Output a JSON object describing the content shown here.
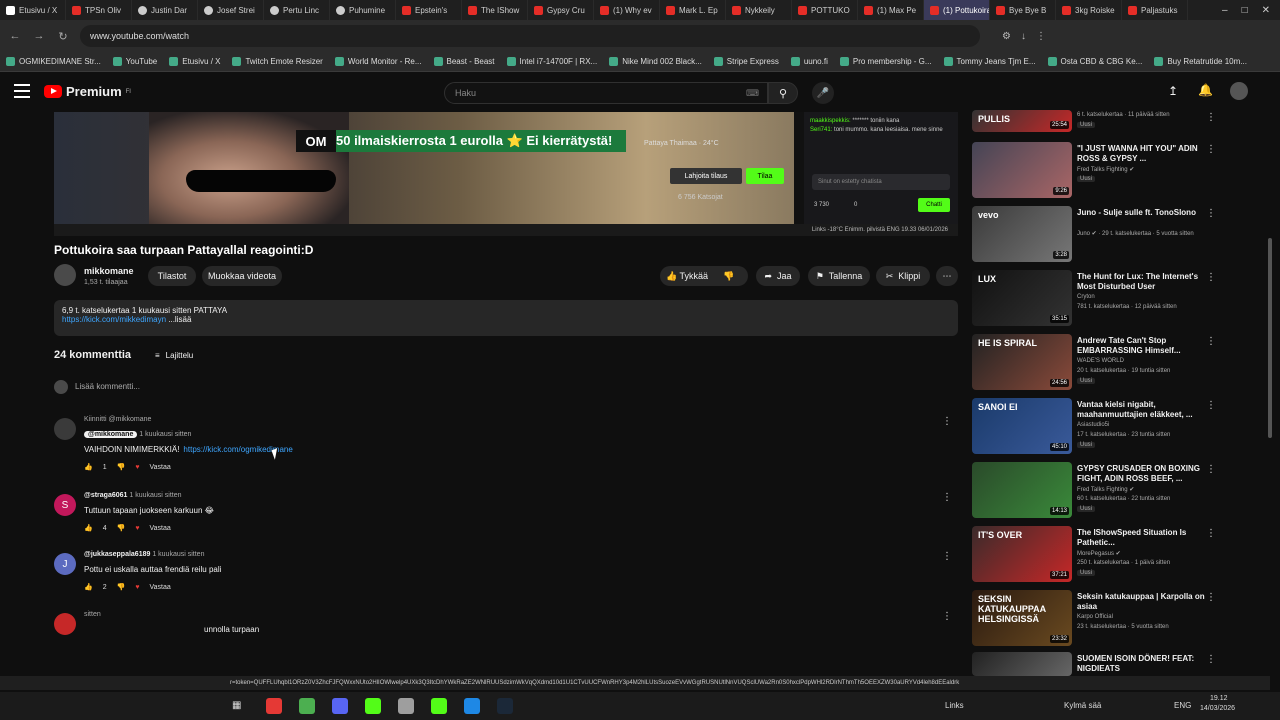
{
  "browser": {
    "tabs": [
      {
        "label": "Etusivu / X",
        "icon": "x-icon"
      },
      {
        "label": "TPSn Oliv",
        "icon": "youtube-icon"
      },
      {
        "label": "Justin Dar",
        "icon": "github-icon"
      },
      {
        "label": "Josef Strei",
        "icon": "github-icon"
      },
      {
        "label": "Pertu Linc",
        "icon": "github-icon"
      },
      {
        "label": "Puhumine",
        "icon": "github-icon"
      },
      {
        "label": "Epstein's",
        "icon": "youtube-icon"
      },
      {
        "label": "The IShow",
        "icon": "youtube-icon"
      },
      {
        "label": "Gypsy Cru",
        "icon": "youtube-icon"
      },
      {
        "label": "(1) Why ev",
        "icon": "youtube-icon"
      },
      {
        "label": "Mark L. Ep",
        "icon": "youtube-icon"
      },
      {
        "label": "Nykkeily",
        "icon": "youtube-icon"
      },
      {
        "label": "POTTUKO",
        "icon": "youtube-icon"
      },
      {
        "label": "(1) Max Pe",
        "icon": "youtube-icon"
      },
      {
        "label": "(1) Pottukoira",
        "icon": "youtube-icon",
        "active": true
      },
      {
        "label": "Bye Bye B",
        "icon": "youtube-icon"
      },
      {
        "label": "3kg Roiske",
        "icon": "youtube-icon"
      },
      {
        "label": "Paljastuks",
        "icon": "youtube-icon"
      }
    ],
    "url": "www.youtube.com/watch",
    "bookmarks": [
      "OGMIKEDIMANE Str...",
      "YouTube",
      "Etusivu / X",
      "Twitch Emote Resizer",
      "World Monitor - Re...",
      "Beast - Beast",
      "Intel i7-14700F | RX...",
      "Nike Mind 002 Black...",
      "Stripe Express",
      "uuno.fi",
      "Pro membership - G...",
      "Tommy Jeans Tjm E...",
      "Osta CBD & CBG Ke...",
      "Buy Retatrutide 10m..."
    ]
  },
  "youtube": {
    "logo": "Premium",
    "logo_sup": "FI",
    "search_placeholder": "Haku"
  },
  "video_overlay": {
    "banner_prefix": "OM",
    "banner": "50 ilmaiskierrosta 1 eurolla ⭐ Ei kierrätystä!",
    "weather": "Pattaya Thaimaa · 24°C",
    "gift_label": "Lahjoita tilaus",
    "follow_label": "Tilaa",
    "viewers": "6 756 Katsojat",
    "chat_lines": [
      {
        "name": "maakkispekkis:",
        "text": "******* toniin kana"
      },
      {
        "name": "Seri741:",
        "text": "toni mummo. kana leesiaisa. mene sinne"
      }
    ],
    "chat_input": "Sinut on estetty chatista",
    "chat_count": "3 730",
    "chat_zero": "0",
    "chat_button": "Chatti",
    "taskbar_text": "Links  -18°C Enimm. pilvistä  ENG  19.33 06/01/2026"
  },
  "video": {
    "title": "Pottukoira saa turpaan Pattayallal reagointi:D",
    "channel": "mikkomane",
    "subscribers": "1,53 t. tilaajaa",
    "stats_label": "Tilastot",
    "edit_label": "Muokkaa videota",
    "like_label": "Tykkää",
    "share_label": "Jaa",
    "save_label": "Tallenna",
    "clip_label": "Klippi",
    "description_meta": "6,9 t. katselukertaa  1 kuukausi sitten  PATTAYA",
    "description_link": "https://kick.com/mikkedimayn",
    "description_more": "...lisää"
  },
  "comments": {
    "count": "24 kommenttia",
    "sort_label": "Lajittelu",
    "add_placeholder": "Lisää kommentti...",
    "reply_label": "Vastaa",
    "items": [
      {
        "pinned": "Kiinnitti @mikkomane",
        "author": "@mikkomane",
        "time": "1 kuukausi sitten",
        "text": "VAIHDOIN NIMIMERKKIÄ!",
        "link": "https://kick.com/ogmikedimane",
        "likes": "1",
        "avatar_letter": "",
        "avatar_color": "#3a3a3a"
      },
      {
        "author": "@straga6061",
        "time": "1 kuukausi sitten",
        "text": "Tuttuun tapaan juokseen karkuun 😂",
        "likes": "4",
        "avatar_letter": "S",
        "avatar_color": "#c2185b"
      },
      {
        "author": "@jukkaseppala6189",
        "time": "1 kuukausi sitten",
        "text": "Pottu ei uskalla  auttaa frendiä reilu pali",
        "likes": "2",
        "avatar_letter": "J",
        "avatar_color": "#5c6bc0"
      },
      {
        "author": "",
        "time": "sitten",
        "text": "unnolla turpaan",
        "likes": "",
        "avatar_letter": "",
        "avatar_color": "#c62828"
      }
    ]
  },
  "sidebar": [
    {
      "title": "",
      "channel": "",
      "meta": "6 t. katselukertaa · 11 päivää sitten",
      "new": "Uusi",
      "duration": "25:54",
      "thumb_text": "PULLIS",
      "colors": [
        "#333",
        "#c62828"
      ]
    },
    {
      "title": "\"I JUST WANNA HIT YOU\" ADIN ROSS & GYPSY ...",
      "channel": "Fred Talks Fighting ✔",
      "meta": "",
      "new": "Uusi",
      "duration": "9:26",
      "thumb_text": "",
      "colors": [
        "#445",
        "#a66"
      ]
    },
    {
      "title": "Juno - Sulje sulle ft. TonoSlono",
      "channel": "Juno ✔ · 29 t. katselukertaa · 5 vuotta sitten",
      "meta": "",
      "new": "",
      "duration": "3:28",
      "thumb_text": "vevo",
      "colors": [
        "#3a3a3a",
        "#777"
      ]
    },
    {
      "title": "The Hunt for Lux: The Internet's Most Disturbed User",
      "channel": "Cryton",
      "meta": "781 t. katselukertaa · 12 päivää sitten",
      "new": "",
      "duration": "35:15",
      "thumb_text": "LUX",
      "colors": [
        "#111",
        "#333"
      ]
    },
    {
      "title": "Andrew Tate Can't Stop EMBARRASSING Himself...",
      "channel": "WADE'S WORLD",
      "meta": "20 t. katselukertaa · 19 tuntia sitten",
      "new": "Uusi",
      "duration": "24:56",
      "thumb_text": "HE IS SPIRAL",
      "colors": [
        "#222",
        "#8a4a3a"
      ]
    },
    {
      "title": "Vantaa kielsi nigabit, maahanmuuttajien eläkkeet, ...",
      "channel": "Asiastudio5i",
      "meta": "17 t. katselukertaa · 23 tuntia sitten",
      "new": "Uusi",
      "duration": "45:10",
      "thumb_text": "SANOI EI",
      "colors": [
        "#1a3a6a",
        "#3a5a9a"
      ]
    },
    {
      "title": "GYPSY CRUSADER ON BOXING FIGHT, ADIN ROSS BEEF, ...",
      "channel": "Fred Talks Fighting ✔",
      "meta": "60 t. katselukertaa · 22 tuntia sitten",
      "new": "Uusi",
      "duration": "14:13",
      "thumb_text": "",
      "colors": [
        "#2a4a2a",
        "#3a8a3a"
      ]
    },
    {
      "title": "The IShowSpeed Situation Is Pathetic...",
      "channel": "MorePegasus ✔",
      "meta": "250 t. katselukertaa · 1 päivä sitten",
      "new": "Uusi",
      "duration": "37:21",
      "thumb_text": "IT'S OVER",
      "colors": [
        "#3a2a2a",
        "#c62828"
      ]
    },
    {
      "title": "Seksin katukauppaa | Karpolla on asiaa",
      "channel": "Karpo Official",
      "meta": "23 t. katselukertaa · 5 vuotta sitten",
      "new": "",
      "duration": "23:32",
      "thumb_text": "SEKSIN KATUKAUPPAA HELSINGISSÄ",
      "colors": [
        "#2a1a10",
        "#6a4a20"
      ]
    },
    {
      "title": "SUOMEN ISOIN DÖNER! FEAT: NIGDIEATS",
      "channel": "",
      "meta": "",
      "new": "",
      "duration": "",
      "thumb_text": "",
      "colors": [
        "#222",
        "#666"
      ]
    }
  ],
  "status_url": "r=token=QUFFLUhqbl1ORzZ0V3ZhcFJFQWxxNUto2HlIOWlwelp4UXk3Q3ItcDhYWkRaZE2WNlRUUSdzimWkVqQXdmd10d1U1CTvUUCFWnRHY3p4M2hlLUtsSuozeEVvWGgtRUSNUtlNnVUQSclUWa2Rn0S0hxclPdpWHl2RDlrNThmTh5OEEXZW30aURYVd4leh8dEEaldrk",
  "taskbar": {
    "links": "Links",
    "weather": "Kylmä sää",
    "lang": "ENG",
    "time": "19.12",
    "date": "14/03/2026"
  },
  "colors": {
    "yt_red": "#ff0000",
    "kick_green": "#53fc18",
    "link_blue": "#3ea6ff",
    "background": "#0f0f0f"
  }
}
